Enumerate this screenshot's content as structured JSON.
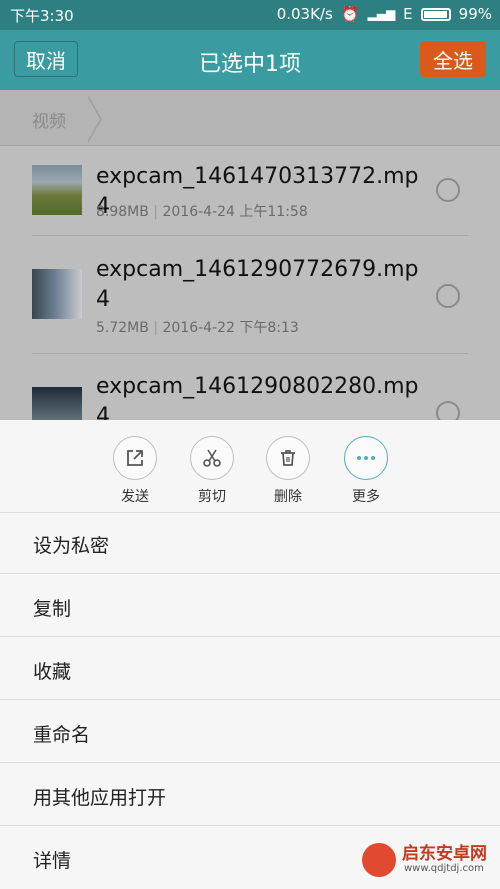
{
  "status": {
    "time": "下午3:30",
    "network_speed": "0.03K/s",
    "net_type": "E",
    "battery": "99%"
  },
  "header": {
    "cancel": "取消",
    "title": "已选中1项",
    "select_all": "全选"
  },
  "breadcrumb": {
    "label": "视频"
  },
  "files": [
    {
      "name": "expcam_1461470313772.mp4",
      "size": "8.98MB",
      "date": "2016-4-24 上午11:58"
    },
    {
      "name": "expcam_1461290772679.mp4",
      "size": "5.72MB",
      "date": "2016-4-22 下午8:13"
    },
    {
      "name": "expcam_1461290802280.mp4"
    }
  ],
  "actions": [
    {
      "label": "发送",
      "icon": "share-icon"
    },
    {
      "label": "剪切",
      "icon": "scissors-icon"
    },
    {
      "label": "删除",
      "icon": "trash-icon"
    },
    {
      "label": "更多",
      "icon": "more-icon"
    }
  ],
  "menu": [
    "设为私密",
    "复制",
    "收藏",
    "重命名",
    "用其他应用打开",
    "详情"
  ],
  "watermark": {
    "text": "启东安卓网",
    "url": "www.qdjtdj.com"
  },
  "colors": {
    "header": "#3a9ca0",
    "select_all": "#d95a1a",
    "accent": "#4fb0b7"
  }
}
